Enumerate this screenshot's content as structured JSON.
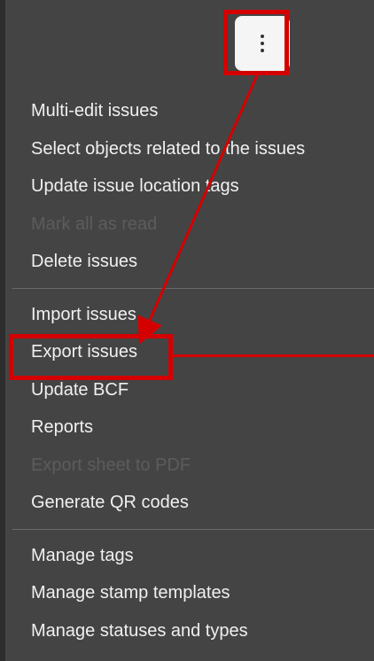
{
  "menu": {
    "group1": [
      {
        "label": "Multi-edit issues",
        "disabled": false
      },
      {
        "label": "Select objects related to the issues",
        "disabled": false
      },
      {
        "label": "Update issue location tags",
        "disabled": false
      },
      {
        "label": "Mark all as read",
        "disabled": true
      },
      {
        "label": "Delete issues",
        "disabled": false
      }
    ],
    "group2": [
      {
        "label": "Import issues",
        "disabled": false
      },
      {
        "label": "Export issues",
        "disabled": false
      },
      {
        "label": "Update BCF",
        "disabled": false
      },
      {
        "label": "Reports",
        "disabled": false
      },
      {
        "label": "Export sheet to PDF",
        "disabled": true
      },
      {
        "label": "Generate QR codes",
        "disabled": false
      }
    ],
    "group3": [
      {
        "label": "Manage tags",
        "disabled": false
      },
      {
        "label": "Manage stamp templates",
        "disabled": false
      },
      {
        "label": "Manage statuses and types",
        "disabled": false
      }
    ]
  },
  "colors": {
    "highlight": "#d40000",
    "menu_bg": "#444444",
    "text": "#f0f0f0",
    "disabled_text": "#5c5c5c"
  },
  "icons": {
    "more_button": "more-vertical-icon"
  }
}
